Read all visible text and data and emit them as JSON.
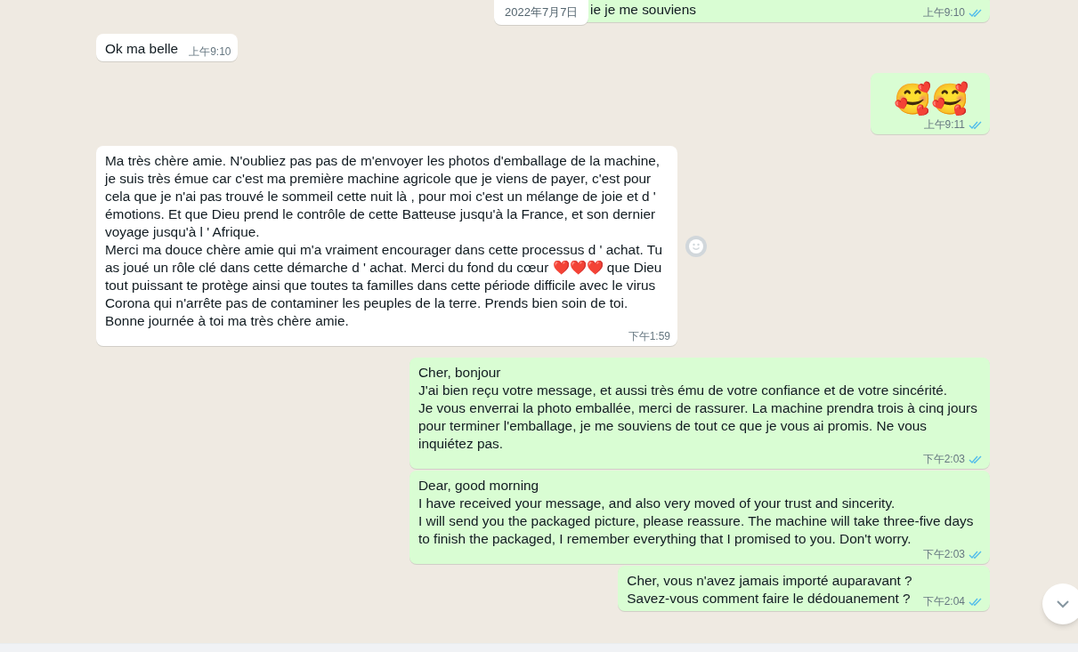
{
  "date_chip": "2022年7月7日",
  "messages": [
    {
      "sent": true,
      "kind": "text",
      "text": "ie je me souviens",
      "time": "上午9:10",
      "read": true
    },
    {
      "sent": false,
      "kind": "text",
      "text": "Ok ma belle",
      "time": "上午9:10"
    },
    {
      "sent": true,
      "kind": "emoji",
      "text": "🥰🥰",
      "time": "上午9:11",
      "read": true
    },
    {
      "sent": false,
      "kind": "text",
      "text": "Ma très chère amie. N'oubliez pas pas de m'envoyer les photos d'emballage de la machine, je suis très émue car c'est ma première machine agricole que je viens de payer, c'est pour cela que je n'ai pas trouvé le sommeil cette nuit là , pour moi c'est un mélange de joie et d ' émotions. Et que Dieu prend le contrôle de cette Batteuse jusqu'à la France, et son dernier voyage jusqu'à l ' Afrique.\nMerci ma douce chère amie qui m'a vraiment encourager dans cette processus d ' achat. Tu as joué un rôle clé dans cette démarche d ' achat. Merci du fond du cœur ❤️❤️❤️ que Dieu tout puissant te protège ainsi que toutes ta familles dans cette période difficile avec le virus Corona qui n'arrête pas de contaminer les peuples de la terre. Prends bien soin de toi.\nBonne journée à toi ma très chère amie.",
      "time": "下午1:59"
    },
    {
      "sent": true,
      "kind": "text",
      "text": "Cher, bonjour\nJ'ai bien reçu votre message, et aussi très ému de votre confiance et de votre sincérité.\nJe vous enverrai la photo emballée, merci de rassurer. La machine prendra trois à cinq jours pour terminer l'emballage, je me souviens de tout ce que je vous ai promis. Ne vous inquiétez pas.",
      "time": "下午2:03",
      "read": true
    },
    {
      "sent": true,
      "kind": "text",
      "text": "Dear, good morning\nI have received your message, and also very moved of your trust and sincerity.\nI will send you the packaged picture, please reassure. The machine will take three-five days to finish the packaged, I remember everything that I promised to you. Don't worry.",
      "time": "下午2:03",
      "read": true
    },
    {
      "sent": true,
      "kind": "text",
      "text": "Cher, vous n'avez jamais importé auparavant ?\nSavez-vous comment faire le dédouanement ?",
      "time": "下午2:04",
      "read": true
    }
  ]
}
